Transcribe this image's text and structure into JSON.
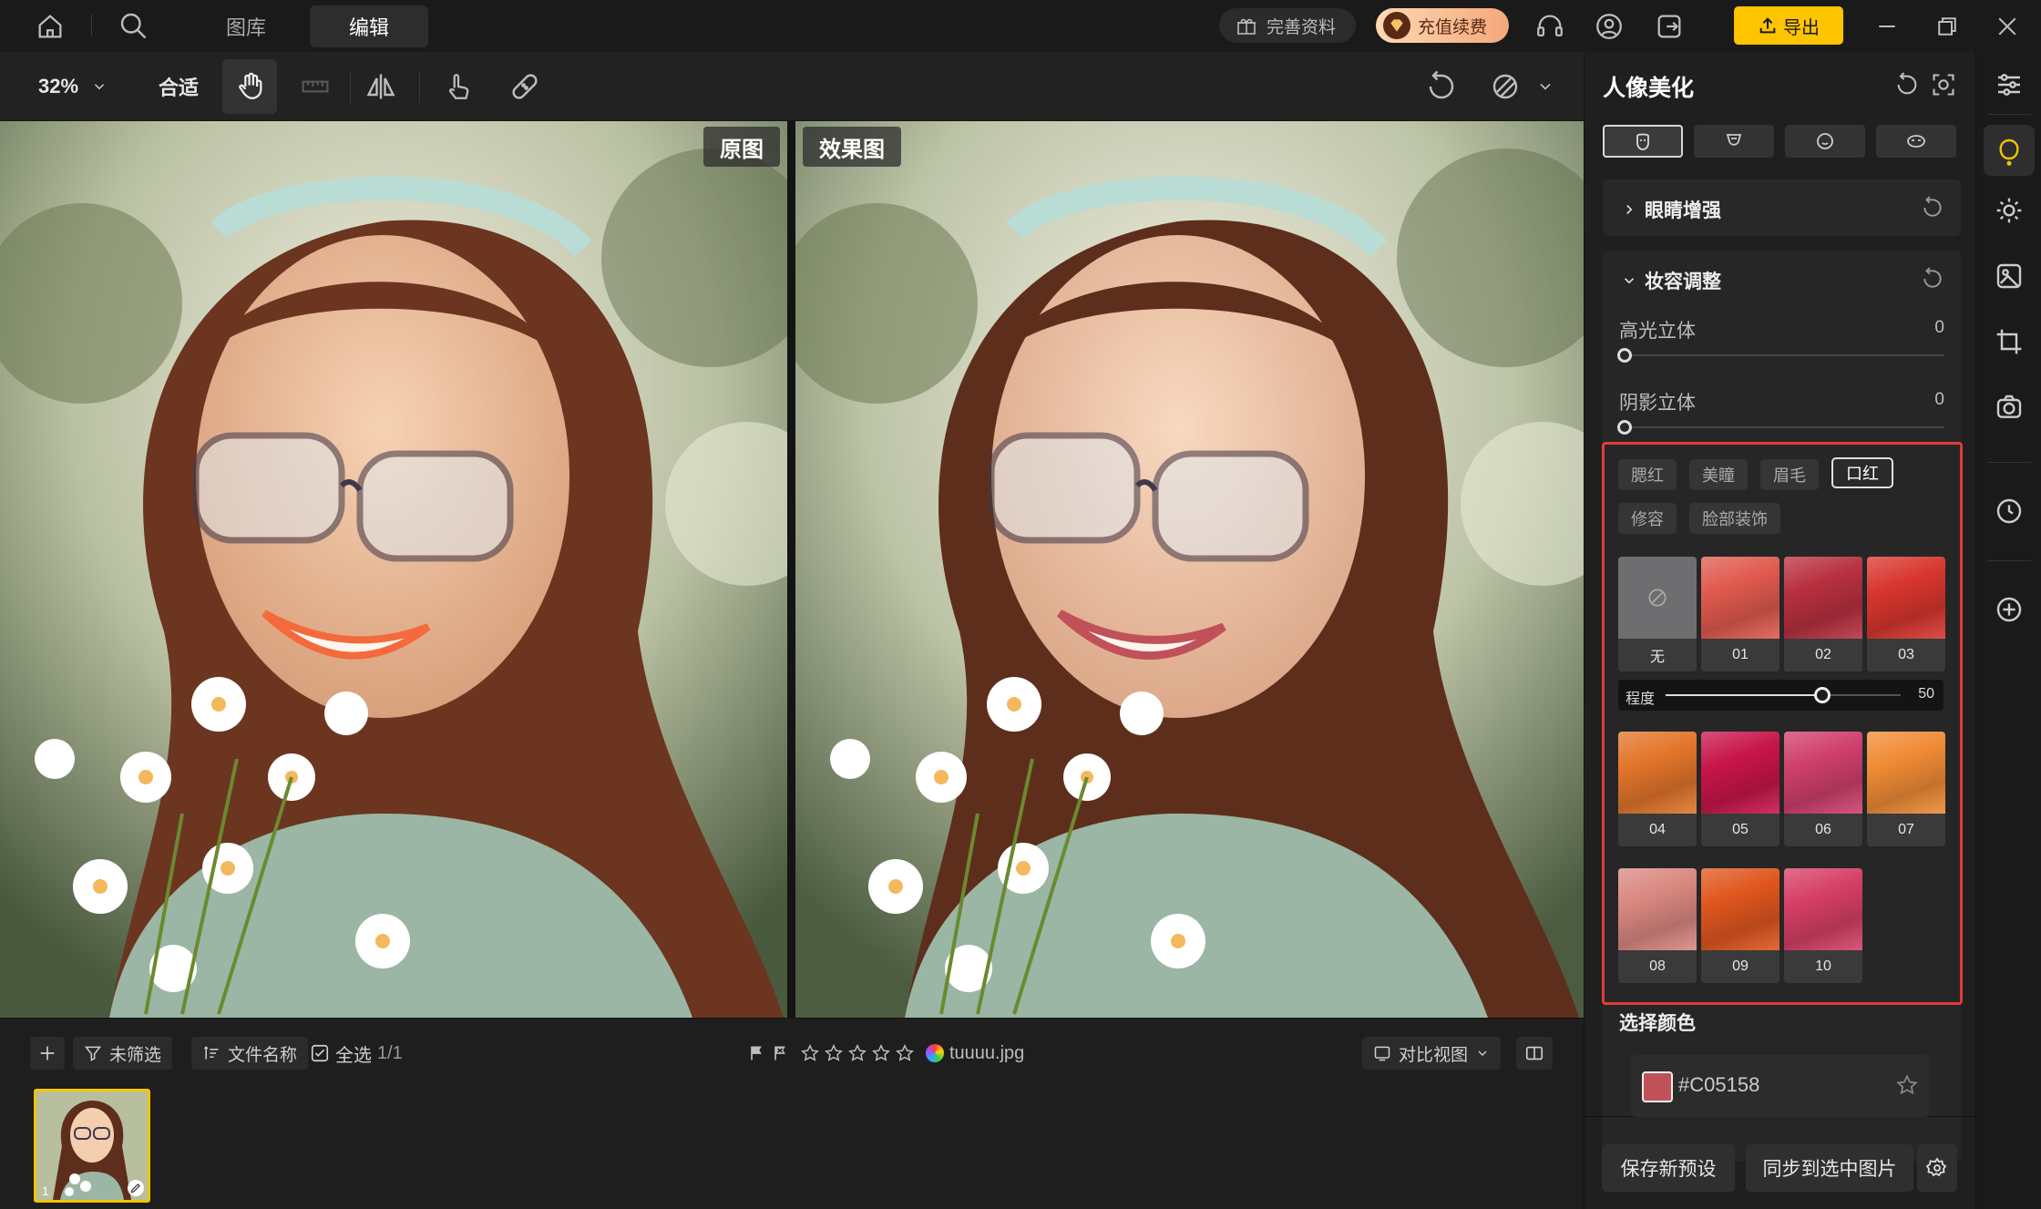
{
  "nav": {
    "tab_library": "图库",
    "tab_edit": "编辑"
  },
  "header": {
    "profile_label": "完善资料",
    "recharge_label": "充值续费",
    "export_label": "导出"
  },
  "toolbar": {
    "zoom": "32%",
    "fit_label": "合适"
  },
  "canvas": {
    "original_label": "原图",
    "result_label": "效果图"
  },
  "filmstrip": {
    "filter_label": "未筛选",
    "sort_label": "文件名称",
    "select_all_label": "全选",
    "count": "1/1",
    "rating_stars": 0,
    "filename": "tuuuu.jpg",
    "view_mode_label": "对比视图",
    "thumb_index": "1"
  },
  "panel": {
    "title": "人像美化",
    "eye_section": "眼睛增强",
    "makeup_section": "妆容调整",
    "highlight": {
      "label": "高光立体",
      "value": "0"
    },
    "shadow": {
      "label": "阴影立体",
      "value": "0"
    },
    "makeup_tabs": [
      "腮红",
      "美瞳",
      "眉毛",
      "口红",
      "修容",
      "脸部装饰"
    ],
    "active_makeup_tab": "口红",
    "swatches": [
      {
        "label": "无",
        "color": "#6e6e70"
      },
      {
        "label": "01",
        "color": "#e05a4e"
      },
      {
        "label": "02",
        "color": "#b8303f"
      },
      {
        "label": "03",
        "color": "#d8362e"
      },
      {
        "label": "04",
        "color": "#e2752a"
      },
      {
        "label": "05",
        "color": "#c8154a"
      },
      {
        "label": "06",
        "color": "#cf3f6d"
      },
      {
        "label": "07",
        "color": "#ef8b35"
      },
      {
        "label": "08",
        "color": "#d98880"
      },
      {
        "label": "09",
        "color": "#e0561e"
      },
      {
        "label": "10",
        "color": "#d63f66"
      }
    ],
    "selected_swatch": "02",
    "strength": {
      "label": "程度",
      "value": "50",
      "max": 100
    },
    "choose_color_label": "选择颜色",
    "color_hex": "#C05158",
    "save_preset_label": "保存新预设",
    "sync_label": "同步到选中图片"
  },
  "colors": {
    "accent": "#ffc400",
    "highlight_box": "#e23a3a",
    "selected_swatch": "#e9b426"
  }
}
